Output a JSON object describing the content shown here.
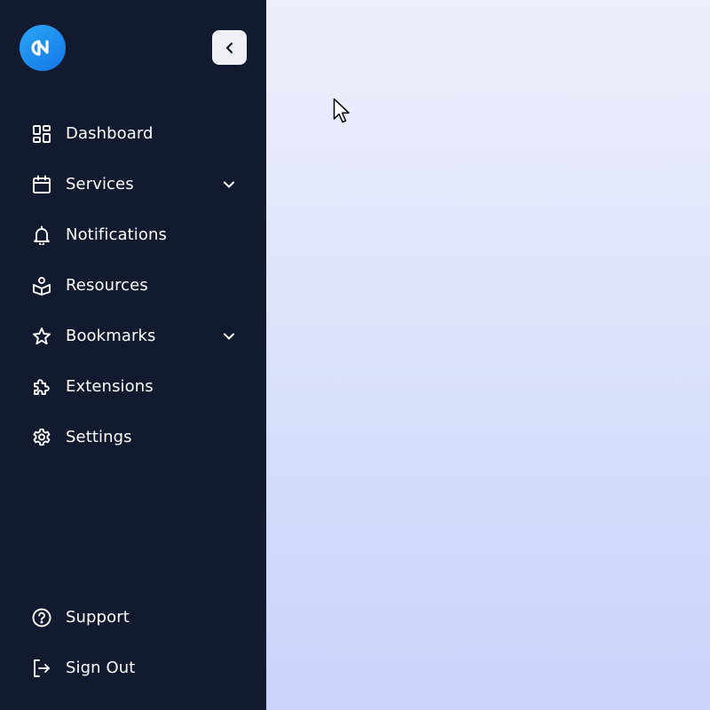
{
  "sidebar": {
    "collapse_button_icon": "chevron-left-icon",
    "logo_icon": "brand-logo-icon",
    "items": [
      {
        "label": "Dashboard",
        "icon": "dashboard-grid-icon",
        "expandable": false
      },
      {
        "label": "Services",
        "icon": "calendar-icon",
        "expandable": true
      },
      {
        "label": "Notifications",
        "icon": "bell-icon",
        "expandable": false
      },
      {
        "label": "Resources",
        "icon": "resources-icon",
        "expandable": false
      },
      {
        "label": "Bookmarks",
        "icon": "star-icon",
        "expandable": true
      },
      {
        "label": "Extensions",
        "icon": "puzzle-icon",
        "expandable": false
      },
      {
        "label": "Settings",
        "icon": "gear-icon",
        "expandable": false
      }
    ],
    "bottom_items": [
      {
        "label": "Support",
        "icon": "help-circle-icon"
      },
      {
        "label": "Sign Out",
        "icon": "sign-out-icon"
      }
    ]
  },
  "colors": {
    "sidebar_bg": "#111a2f",
    "logo_gradient_start": "#2aa6f5",
    "logo_gradient_end": "#1576e8",
    "main_bg_top": "#edeffb",
    "main_bg_bottom": "#c9d3fb",
    "text": "#ffffff"
  }
}
